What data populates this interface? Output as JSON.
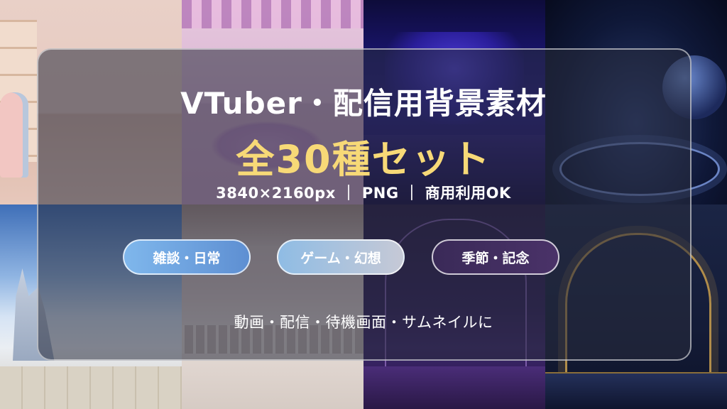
{
  "title": "VTuber・配信用背景素材",
  "subtitle": "全30種セット",
  "spec": "3840×2160px ｜ PNG ｜ 商用利用OK",
  "categories": [
    {
      "label": "雑談・日常"
    },
    {
      "label": "ゲーム・幻想"
    },
    {
      "label": "季節・記念"
    }
  ],
  "footer": "動画・配信・待機画面・サムネイルに",
  "colors": {
    "accent_title": "#f7d977",
    "text": "#ffffff",
    "panel": "rgba(40,44,60,0.55)"
  }
}
